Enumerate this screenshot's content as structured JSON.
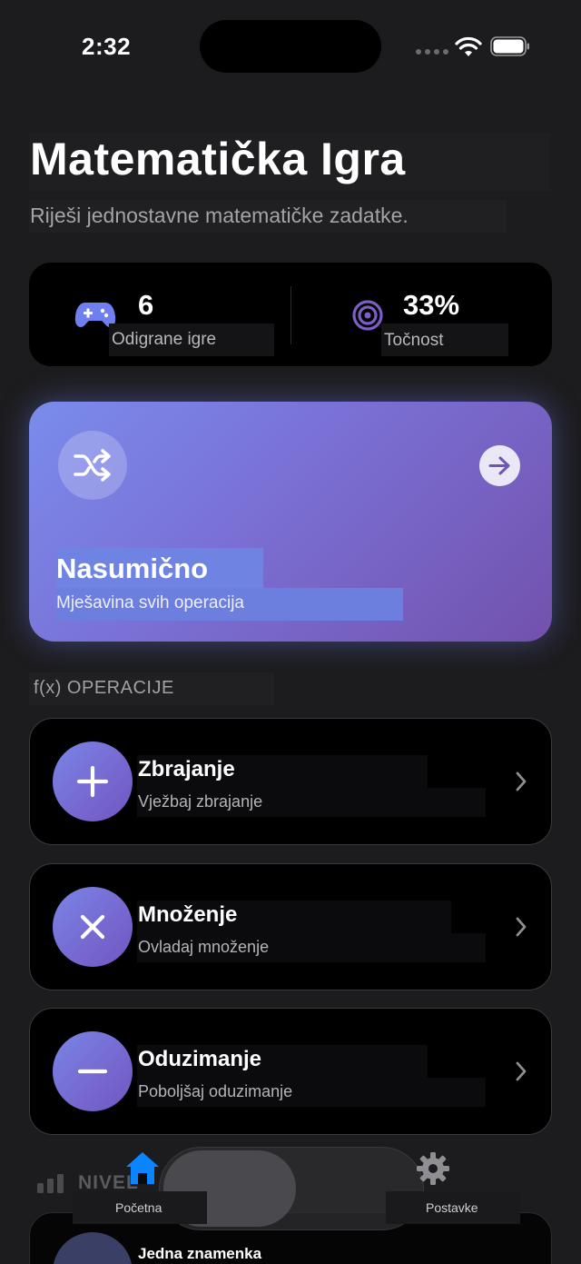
{
  "status_bar": {
    "time": "2:32"
  },
  "header": {
    "title": "Matematička Igra",
    "subtitle": "Riješi jednostavne matematičke zadatke."
  },
  "stats": {
    "games": {
      "value": "6",
      "label": "Odigrane igre",
      "icon": "gamepad-icon"
    },
    "accuracy": {
      "value": "33%",
      "label": "Točnost",
      "icon": "target-icon"
    }
  },
  "random_card": {
    "title": "Nasumično",
    "subtitle": "Mješavina svih operacija",
    "icon": "shuffle-icon",
    "action_icon": "arrow-right-icon"
  },
  "operations_section": {
    "title": "f(x) OPERACIJE",
    "items": [
      {
        "title": "Zbrajanje",
        "subtitle": "Vježbaj zbrajanje",
        "icon": "plus-icon"
      },
      {
        "title": "Množenje",
        "subtitle": "Ovladaj množenje",
        "icon": "multiply-icon"
      },
      {
        "title": "Oduzimanje",
        "subtitle": "Poboljšaj oduzimanje",
        "icon": "minus-icon"
      }
    ]
  },
  "level_section": {
    "title": "NIVEL",
    "first_item": "Jedna znamenka"
  },
  "tab_bar": {
    "tabs": [
      {
        "label": "Početna",
        "icon": "home-icon",
        "active": true
      },
      {
        "label": "Postavke",
        "icon": "gear-icon",
        "active": false
      }
    ]
  },
  "colors": {
    "background": "#1c1c1e",
    "card": "#000000",
    "accent_blue": "#0a84ff",
    "gradient_start": "#7a8cec",
    "gradient_end": "#7252ad"
  }
}
